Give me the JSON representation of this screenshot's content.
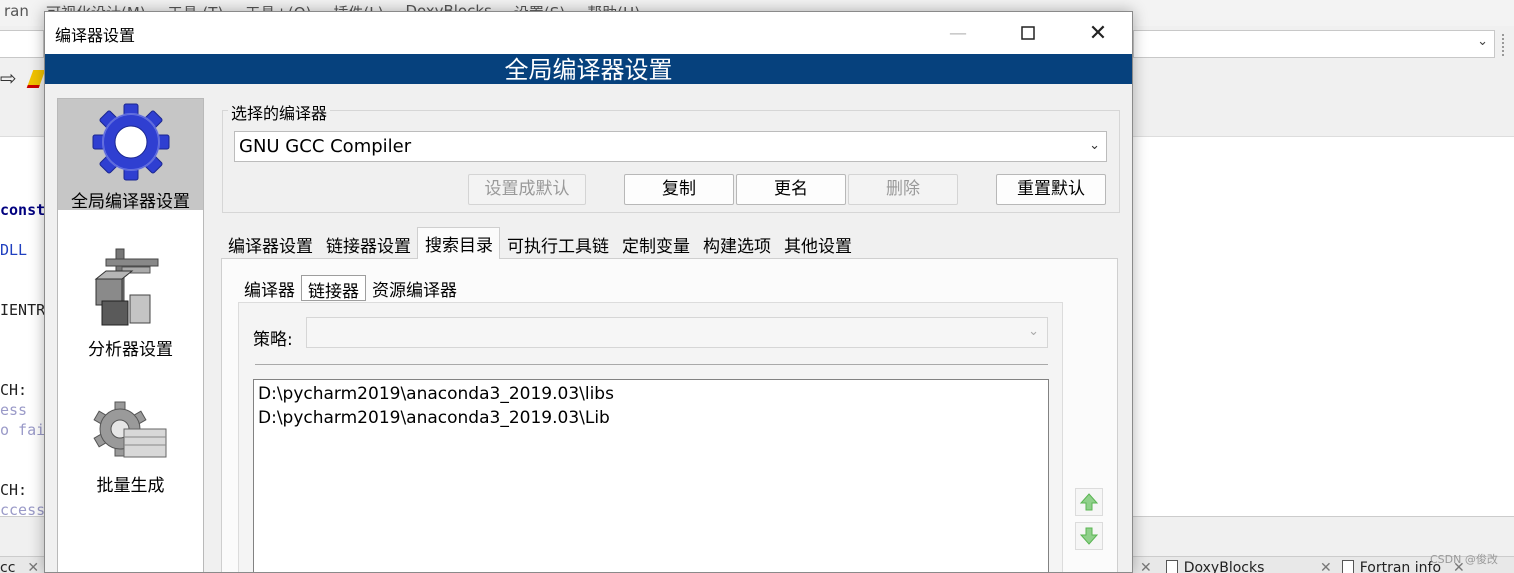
{
  "ide": {
    "app_fragment": "ran",
    "menu": [
      "可视化设计(M)",
      "工具 (T)",
      "工具+(O)",
      "插件(L)",
      "DoxyBlocks",
      "设置(S)",
      "帮助(H)"
    ],
    "code_fragments": [
      "const",
      "DLL ",
      "IENTR",
      "CH:",
      "ess",
      "o fai",
      "CH:",
      "ccess"
    ],
    "bottom_tabs": [
      "cc",
      "DoxyBlocks",
      "Fortran info"
    ]
  },
  "watermark": "CSDN @俊改",
  "dialog": {
    "title": "编译器设置",
    "banner": "全局编译器设置",
    "side_items": [
      "全局编译器设置",
      "分析器设置",
      "批量生成"
    ],
    "compiler_group_label": "选择的编译器",
    "selected_compiler": "GNU GCC Compiler",
    "buttons": {
      "set_default": "设置成默认",
      "copy": "复制",
      "rename": "更名",
      "delete": "删除",
      "reset_default": "重置默认"
    },
    "tabs": [
      "编译器设置",
      "链接器设置",
      "搜索目录",
      "可执行工具链",
      "定制变量",
      "构建选项",
      "其他设置"
    ],
    "active_tab": "搜索目录",
    "subtabs": [
      "编译器",
      "链接器",
      "资源编译器"
    ],
    "active_subtab": "链接器",
    "policy_label": "策略:",
    "policy_value": "",
    "directories": [
      "D:\\pycharm2019\\anaconda3_2019.03\\libs",
      "D:\\pycharm2019\\anaconda3_2019.03\\Lib"
    ]
  },
  "colors": {
    "banner_bg": "#06417d",
    "selection_bg": "#c6c6c6",
    "gear_blue": "#2f3fd1",
    "arrow_green": "#5ab552"
  },
  "icons": {
    "global_settings": "blue-gear-icon",
    "profiler": "caliper-cubes-icon",
    "batch_build": "gear-cubes-icon",
    "move_up": "green-up-arrow-icon",
    "move_down": "green-down-arrow-icon",
    "dropdown": "chevron-down-icon"
  }
}
